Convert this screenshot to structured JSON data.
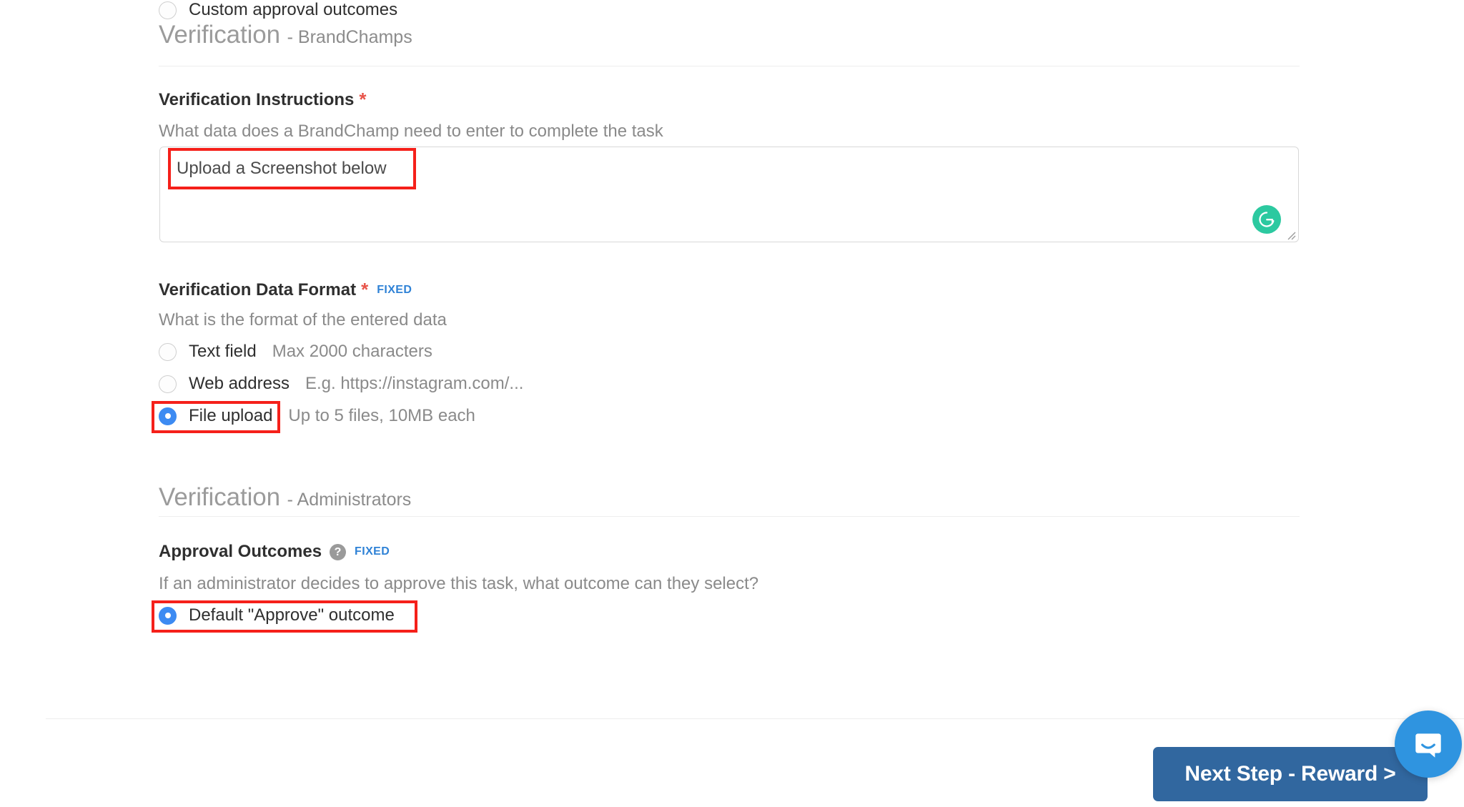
{
  "sections": [
    {
      "title": "Verification",
      "subtitle": "- BrandChamps"
    },
    {
      "title": "Verification",
      "subtitle": "- Administrators"
    }
  ],
  "instructions": {
    "label": "Verification Instructions",
    "required_marker": "*",
    "hint": "What data does a BrandChamp need to enter to complete the task",
    "value": "Upload a Screenshot below",
    "grammarly_icon": "grammarly-icon",
    "grammarly_letter": "G"
  },
  "data_format": {
    "label": "Verification Data Format",
    "required_marker": "*",
    "badge": "FIXED",
    "hint": "What is the format of the entered data",
    "options": [
      {
        "label": "Text field",
        "desc": "Max 2000 characters",
        "selected": false
      },
      {
        "label": "Web address",
        "desc": "E.g. https://instagram.com/...",
        "selected": false
      },
      {
        "label": "File upload",
        "desc": "Up to 5 files, 10MB each",
        "selected": true
      }
    ]
  },
  "approval": {
    "label": "Approval Outcomes",
    "help_icon": "help-icon",
    "help_glyph": "?",
    "badge": "FIXED",
    "hint": "If an administrator decides to approve this task, what outcome can they select?",
    "options": [
      {
        "label": "Default \"Approve\" outcome",
        "selected": true
      },
      {
        "label": "Custom approval outcomes",
        "selected": false
      }
    ]
  },
  "footer": {
    "next_button": "Next Step - Reward >",
    "chat_icon": "chat-bubble-icon"
  },
  "colors": {
    "accent_blue": "#3d8bf2",
    "badge_blue": "#2f82d6",
    "required_red": "#e8544a",
    "annotation_red": "#f5201a",
    "button_blue": "#31679f",
    "intercom_blue": "#2f94e0",
    "grammarly_green": "#2cc9a0"
  }
}
